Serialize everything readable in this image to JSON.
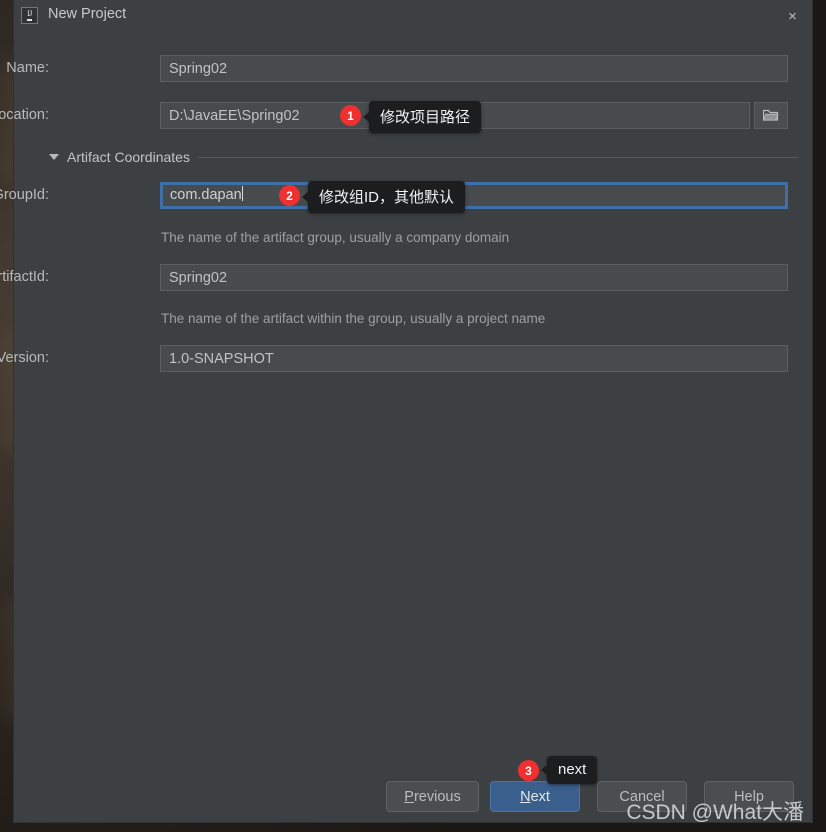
{
  "window": {
    "title": "New Project",
    "logo_text": "IJ",
    "close_label": "×"
  },
  "form": {
    "name": {
      "label": "Name:",
      "value": "Spring02"
    },
    "location": {
      "label": "Location:",
      "value": "D:\\JavaEE\\Spring02",
      "browse_label": ""
    },
    "section": {
      "label": "Artifact Coordinates"
    },
    "group_id": {
      "label": "GroupId:",
      "value": "com.dapan",
      "hint": "The name of the artifact group, usually a company domain"
    },
    "artifact_id": {
      "label": "ArtifactId:",
      "value": "Spring02",
      "hint": "The name of the artifact within the group, usually a project name"
    },
    "version": {
      "label": "Version:",
      "value": "1.0-SNAPSHOT"
    }
  },
  "annotations": [
    {
      "number": "1",
      "text": "修改项目路径"
    },
    {
      "number": "2",
      "text": "修改组ID，其他默认"
    },
    {
      "number": "3",
      "text": "next"
    }
  ],
  "buttons": {
    "previous": {
      "pre": "",
      "mnemonic": "P",
      "post": "revious"
    },
    "next": {
      "pre": "",
      "mnemonic": "N",
      "post": "ext"
    },
    "cancel": {
      "label": "Cancel"
    },
    "help": {
      "label": "Help"
    }
  },
  "watermark": {
    "text": "CSDN @What大潘"
  },
  "colors": {
    "dialog_bg": "#3c4043",
    "field_bg": "#474b4e",
    "accent_focus": "#3f6fa8",
    "primary_button": "#3a5f8c",
    "badge_red": "#f03030",
    "tooltip_bg": "#1b1d1f"
  }
}
